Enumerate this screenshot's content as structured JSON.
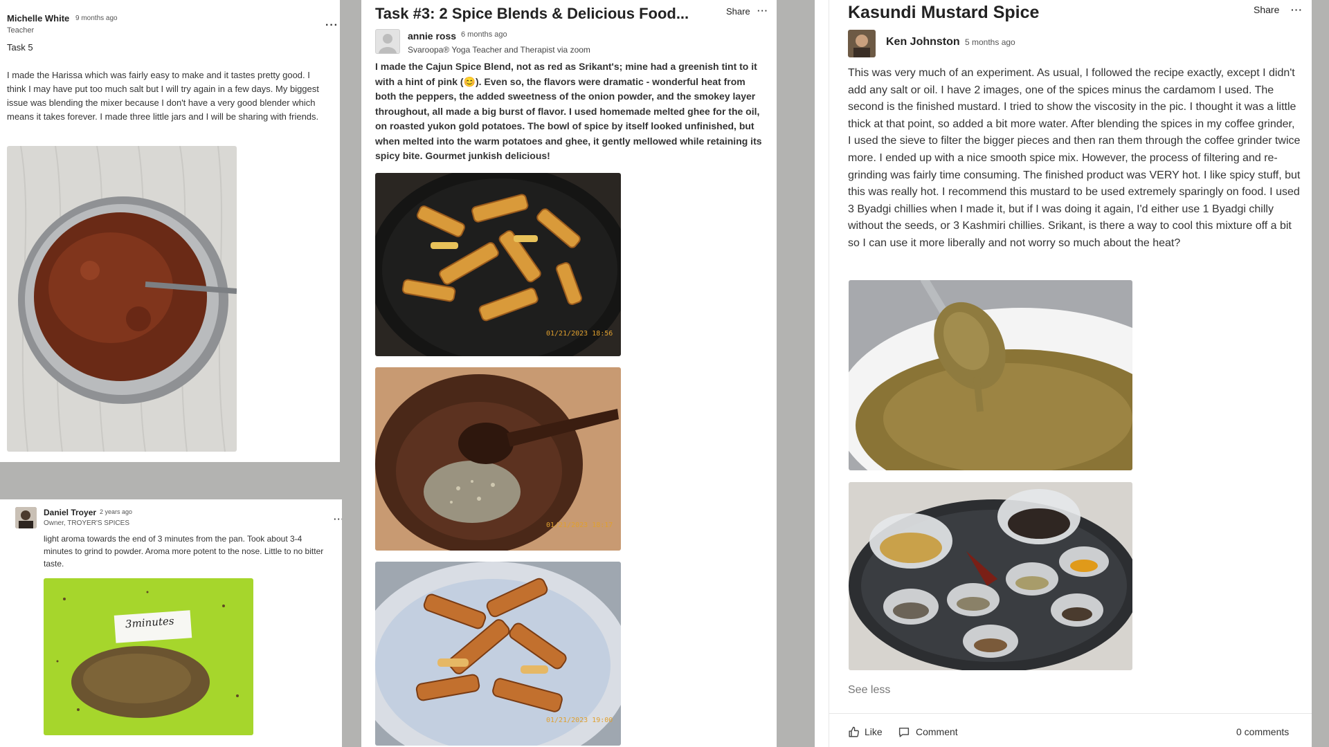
{
  "post1": {
    "author": "Michelle White",
    "time": "9 months ago",
    "role": "Teacher",
    "title": "Task 5",
    "body": "I made the Harissa which was fairly easy to make and it tastes pretty good. I think I may have put too much salt but I will try again in a few days. My biggest issue was blending the mixer because I don't have a very good blender which means it takes forever. I made three little jars and I will be sharing with friends.",
    "more_icon": "more-dots-icon"
  },
  "post2": {
    "author": "Daniel Troyer",
    "time": "2 years ago",
    "role": "Owner, TROYER'S SPICES",
    "body": "light aroma towards the end of 3 minutes from the pan. Took about 3-4 minutes to grind to powder. Aroma more potent to the nose. Little to no bitter taste.",
    "image_label": "3minutes"
  },
  "post3": {
    "title": "Task #3: 2 Spice Blends & Delicious Food...",
    "share": "Share",
    "author": "annie ross",
    "time": "6 months ago",
    "role": "Svaroopa® Yoga Teacher and Therapist via zoom",
    "body_before_emoji": "I made the Cajun Spice Blend, not as red as Srikant's; mine had a greenish tint to it with a hint of pink (",
    "emoji": "😊",
    "body_after_emoji": "). Even so, the flavors were dramatic - wonderful heat from both the peppers, the added sweetness of the onion powder, and the smokey layer throughout, all made a big burst of flavor.  I used homemade melted ghee for the oil, on roasted yukon gold potatoes.  The bowl of spice by itself looked unfinished, but when melted into the warm potatoes and ghee, it gently mellowed while retaining its spicy bite.  Gourmet junkish delicious!",
    "stamp1": "01/21/2023 18:56",
    "stamp2": "01/21/2023 18:17",
    "stamp3": "01/21/2023 19:00"
  },
  "post4": {
    "title": "Kasundi Mustard Spice",
    "share": "Share",
    "author": "Ken Johnston",
    "time": "5 months ago",
    "body": "This was very much of an experiment. As usual, I followed the recipe exactly, except I didn't add any salt or oil. I have 2 images, one of the spices minus the cardamom I used. The second is the finished mustard. I tried to show the viscosity in the pic. I thought it was a little thick at that point, so added a bit more water. After blending the spices in my coffee grinder, I used the sieve to filter the bigger pieces and then ran them through the coffee grinder twice more. I ended up with a nice smooth spice mix. However, the process of filtering and re-grinding was fairly time consuming. The finished product was VERY hot. I like spicy stuff, but this was really hot. I recommend this mustard to be used extremely sparingly on food. I used 3 Byadgi chillies when I made it, but if I was doing it again, I'd either use 1 Byadgi chilly without the seeds, or 3 Kashmiri chillies. Srikant, is there a way to cool this mixture off a bit so I can use it more liberally and not worry so much about the heat?",
    "see_less": "See less",
    "like": "Like",
    "comment": "Comment",
    "comments_count": "0 comments"
  },
  "icons": {
    "like": "thumbs-up-icon",
    "comment": "comment-bubble-icon",
    "more": "more-dots-icon"
  }
}
